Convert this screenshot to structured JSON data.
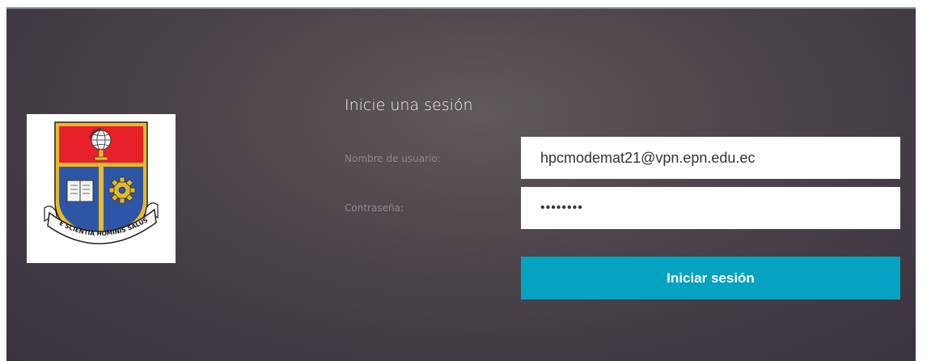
{
  "login": {
    "title": "Inicie una sesión",
    "username_label": "Nombre de usuario:",
    "username_value": "hpcmodemat21@vpn.epn.edu.ec",
    "password_label": "Contraseña:",
    "password_value": "••••••••",
    "submit_label": "Iniciar sesión"
  },
  "logo": {
    "motto": "E SCIENTIA HOMINIS SALUS",
    "icon": "epn-coat-of-arms"
  },
  "colors": {
    "accent": "#05a2c1",
    "panel_background": "#4a4349",
    "shield_red": "#e8202a",
    "shield_blue": "#2e56a6",
    "shield_gold": "#e5b92c"
  }
}
